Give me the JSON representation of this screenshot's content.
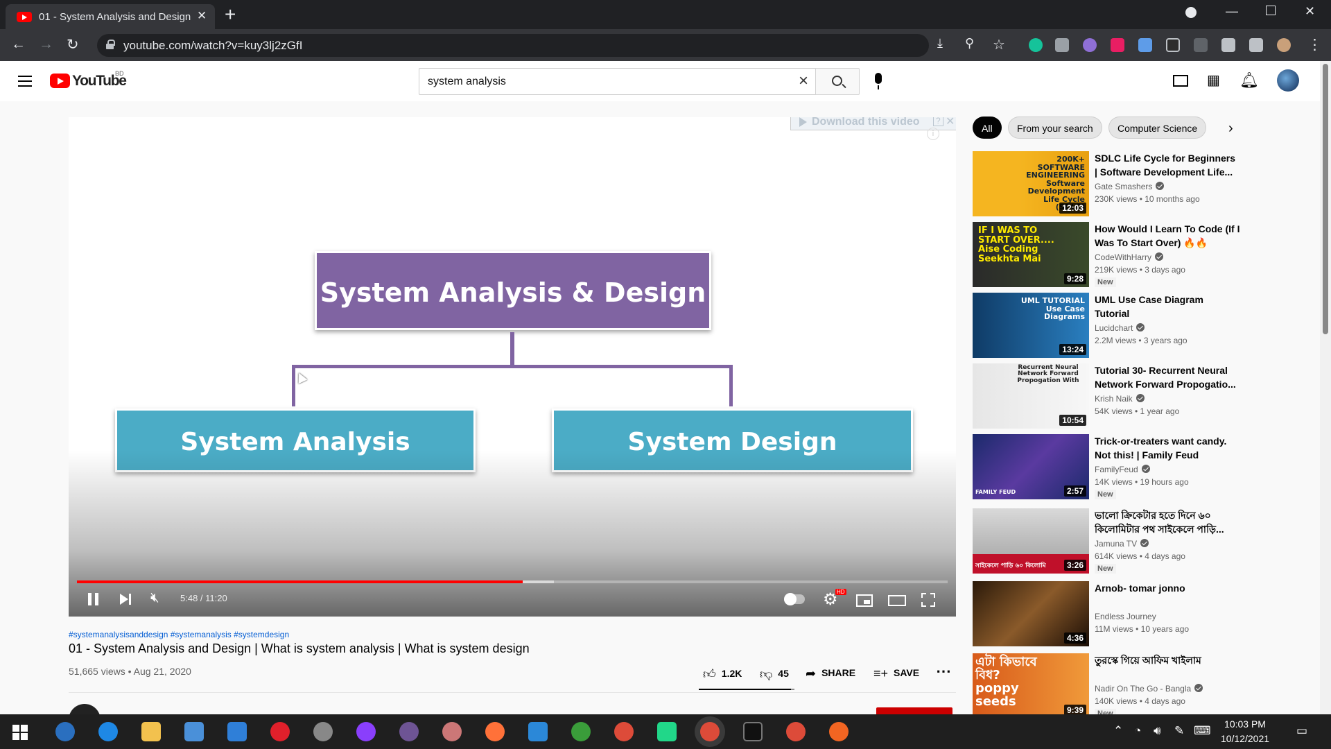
{
  "browser": {
    "tab_title": "01 - System Analysis and Design",
    "url": "youtube.com/watch?v=kuy3lj2zGfI",
    "colors": {
      "tabbar": "#202124",
      "toolbar": "#35363a"
    }
  },
  "youtube": {
    "logo_text": "YouTube",
    "region": "BD",
    "search_query": "system analysis"
  },
  "player": {
    "overlay_download": "Download this video",
    "overlay_help": "?",
    "slide": {
      "main": "System Analysis & Design",
      "left": "System Analysis",
      "right": "System Design"
    },
    "time_display": "5:48 / 11:20",
    "progress_played_fraction": 0.512,
    "progress_buffered_fraction": 0.5475,
    "hd_badge": "HD"
  },
  "video": {
    "hashtags": "#systemanalysisanddesign #systemanalysis #systemdesign",
    "title": "01 - System Analysis and Design | What is system analysis | What is system design",
    "meta": "51,665 views • Aug 21, 2020",
    "likes": "1.2K",
    "dislikes": "45",
    "share_label": "SHARE",
    "save_label": "SAVE",
    "like_ratio": 0.964
  },
  "chips": [
    "All",
    "From your search",
    "Computer Science"
  ],
  "recommendations": [
    {
      "title": "SDLC Life Cycle for Beginners | Software Development Life...",
      "channel": "Gate Smashers",
      "verified": true,
      "stats": "230K views • 10 months ago",
      "duration": "12:03",
      "badge": "",
      "thumb_text": "200K+ SOFTWARE ENGINEERING Software Development Life Cycle (SDLC)"
    },
    {
      "title": "How Would I Learn To Code (If I Was To Start Over) 🔥🔥",
      "channel": "CodeWithHarry",
      "verified": true,
      "stats": "219K views • 3 days ago",
      "duration": "9:28",
      "badge": "New",
      "thumb_text": "IF I WAS TO START OVER.... Aise Coding Seekhta Mai"
    },
    {
      "title": "UML Use Case Diagram Tutorial",
      "channel": "Lucidchart",
      "verified": true,
      "stats": "2.2M views • 3 years ago",
      "duration": "13:24",
      "badge": "",
      "thumb_text": "UML TUTORIAL Use Case Diagrams"
    },
    {
      "title": "Tutorial 30- Recurrent Neural Network Forward Propogatio...",
      "channel": "Krish Naik",
      "verified": true,
      "stats": "54K views • 1 year ago",
      "duration": "10:54",
      "badge": "",
      "thumb_text": "Recurrent Neural Network Forward Propogation With"
    },
    {
      "title": "Trick-or-treaters want candy. Not this! | Family Feud",
      "channel": "FamilyFeud",
      "verified": true,
      "stats": "14K views • 19 hours ago",
      "duration": "2:57",
      "badge": "New",
      "thumb_text": "FAMILY FEUD"
    },
    {
      "title": "ভালো ক্রিকেটার হতে দিনে ৬০ কিলোমিটার পথ সাইকেলে পাড়ি...",
      "channel": "Jamuna TV",
      "verified": true,
      "stats": "614K views • 4 days ago",
      "duration": "3:26",
      "badge": "New",
      "thumb_text": "সাইকেলে পাড়ি ৬০ কিলোমি"
    },
    {
      "title": "Arnob- tomar jonno",
      "channel": "Endless Journey",
      "verified": false,
      "stats": "11M views • 10 years ago",
      "duration": "4:36",
      "badge": "",
      "thumb_text": ""
    },
    {
      "title": "তুরস্কে গিয়ে আফিম খাইলাম",
      "channel": "Nadir On The Go - Bangla",
      "verified": true,
      "stats": "140K views • 4 days ago",
      "duration": "9:39",
      "badge": "New",
      "thumb_text": "এটা কিভাবে বিধ? poppy seeds"
    }
  ],
  "taskbar": {
    "time": "10:03 PM",
    "date": "10/12/2021"
  }
}
